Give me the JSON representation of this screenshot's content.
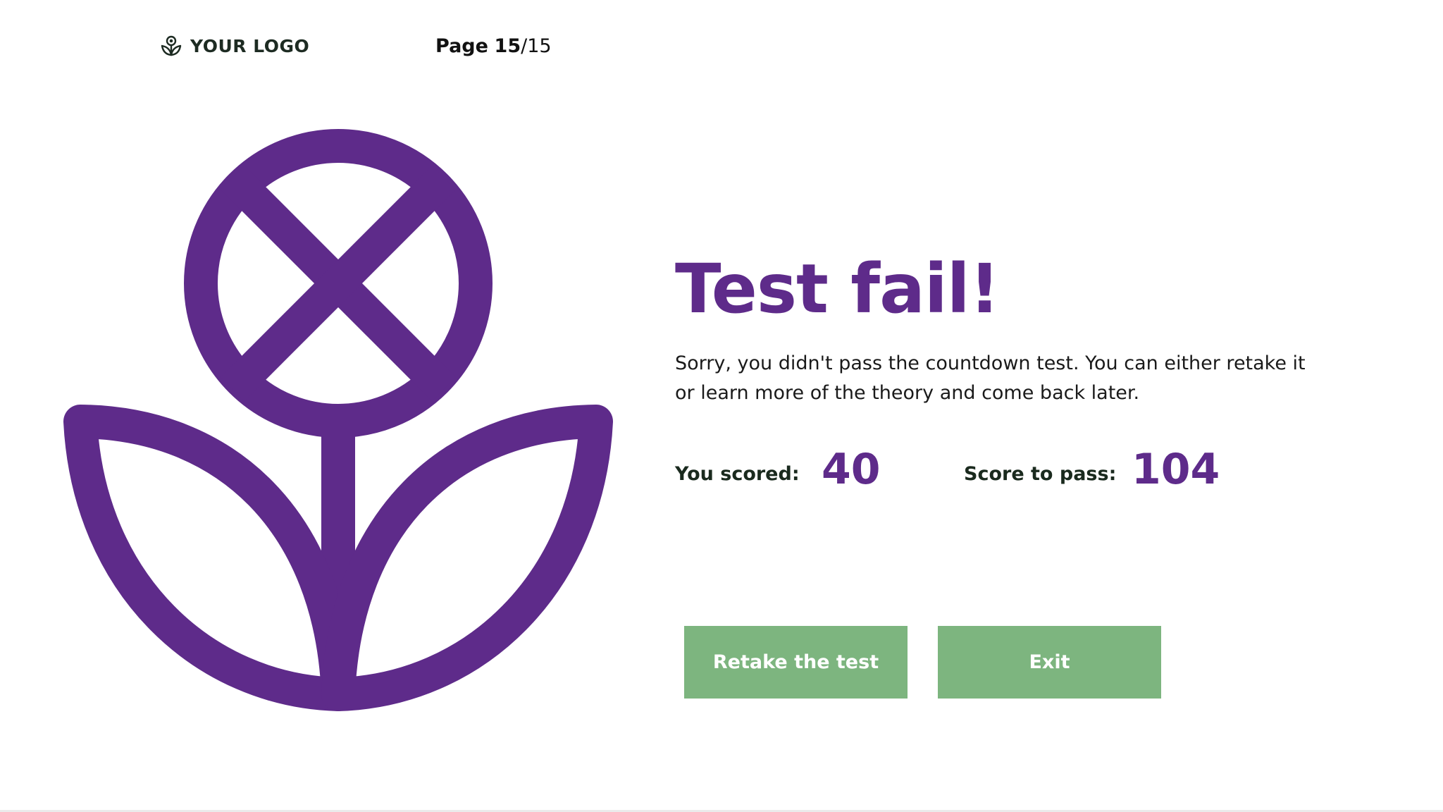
{
  "header": {
    "logo_text": "YOUR LOGO",
    "logo_icon": "flower-icon",
    "page_label": "Page",
    "page_current": "15",
    "page_separator": "/",
    "page_total": "15"
  },
  "illustration": {
    "icon": "failed-flower-icon"
  },
  "result": {
    "title": "Test fail!",
    "message": "Sorry, you didn't pass the countdown test. You can either retake it or learn more of the theory and come back later.",
    "you_scored_label": "You scored:",
    "you_scored_value": "40",
    "score_to_pass_label": "Score to pass:",
    "score_to_pass_value": "104"
  },
  "actions": {
    "retake_label": "Retake the test",
    "exit_label": "Exit"
  },
  "colors": {
    "accent": "#5e2b8a",
    "button": "#7db57f",
    "button_text": "#ffffff",
    "logo_text": "#1d2b22"
  }
}
